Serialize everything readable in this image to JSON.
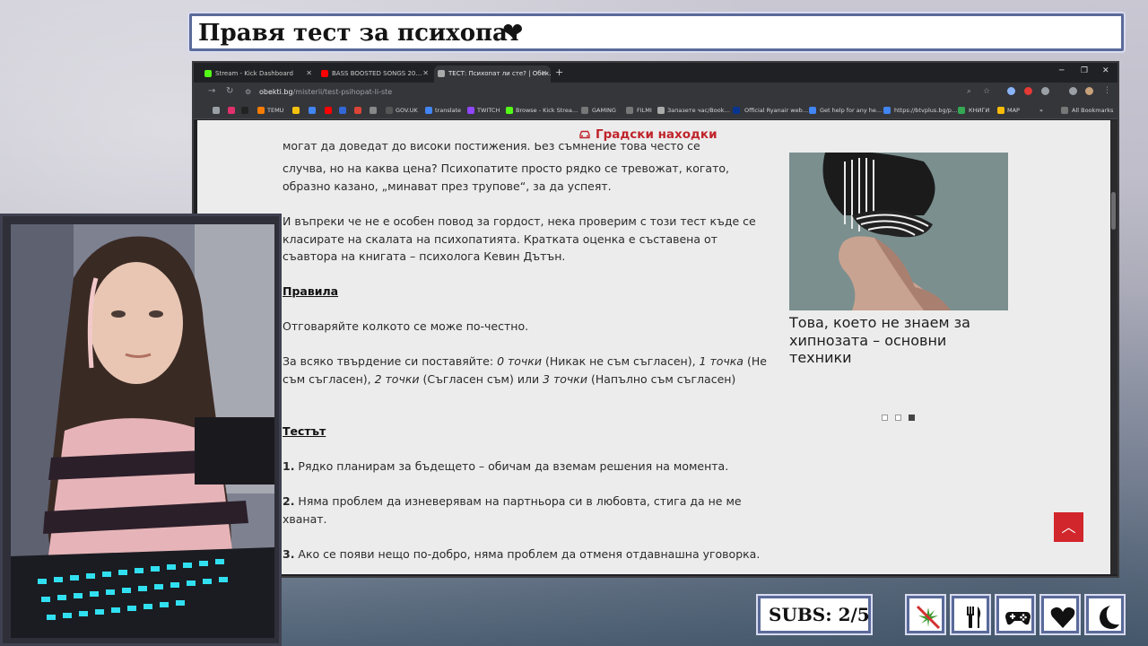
{
  "stream": {
    "title": "Правя тест за психопат",
    "subs": "SUBS: 2/5",
    "icons": [
      "no-cannabis-icon",
      "fork-knife-icon",
      "gamepad-icon",
      "heart-icon",
      "moon-icon"
    ]
  },
  "browser": {
    "tabs": [
      {
        "label": "Stream - Kick Dashboard",
        "icon": "kick-icon",
        "color": "#53fc18",
        "active": false
      },
      {
        "label": "BASS BOOSTED SONGS 20…",
        "icon": "youtube-icon",
        "color": "#ff0000",
        "active": false
      },
      {
        "label": "ТЕСТ: Психопат ли сте? | Обек…",
        "icon": "site-icon",
        "color": "#aaaaaa",
        "active": true
      }
    ],
    "url_domain": "obekti.bg",
    "url_path": "/misterii/test-psihopat-li-ste",
    "bookmarks": [
      "TEMU",
      "GOV.UK",
      "translate",
      "TWITCH",
      "Browse - Kick Strea…",
      "GAMING",
      "FILMI",
      "Запазете час/Book…",
      "Official Ryanair web…",
      "Get help for any he…",
      "https://btvplus.bg/p…",
      "КНИГИ",
      "MAP",
      "All Bookmarks"
    ]
  },
  "page": {
    "header_link": "Градски находки",
    "paragraphs": {
      "p1_line0": "могат да доведат до високи постижения. Без съмнение това често се",
      "p1_rest": "случва, но на каква цена? Психопатите просто рядко се тревожат, когато, образно казано, „минават през трупове“, за да успеят.",
      "p2": "И въпреки че не е особен повод за гордост, нека проверим с този тест къде се класирате на скалата на психопатията. Кратката оценка е съставена от съавтора на книгата – психолога Кевин Дътън.",
      "rules_heading": "Правила",
      "p3": "Отговаряйте колкото се може по-честно.",
      "p4_a": "За всяко твърдение си поставяйте: ",
      "p4_b": "0 точки",
      "p4_c": " (Никак не съм съгласен), ",
      "p4_d": "1 точка",
      "p4_e": " (Не съм съгласен), ",
      "p4_f": "2 точки",
      "p4_g": " (Съгласен съм) или ",
      "p4_h": "3 точки",
      "p4_i": " (Напълно съм съгласен)",
      "test_heading": "Тестът",
      "q1_num": "1.",
      "q1": " Рядко планирам за бъдещето – обичам да вземам решения на момента.",
      "q2_num": "2.",
      "q2": " Няма проблем да изневерявам на партньора си в любовта, стига да не ме хванат.",
      "q3_num": "3.",
      "q3": " Ако се появи нещо по-добро, няма проблем да отменя отдавнашна уговорка."
    },
    "sidebar_caption": "Това, което не знаем за хипнозата – основни техники",
    "carousel_active": 3
  },
  "colors": {
    "accent": "#c0242b",
    "frame": "#5a6a9a"
  }
}
